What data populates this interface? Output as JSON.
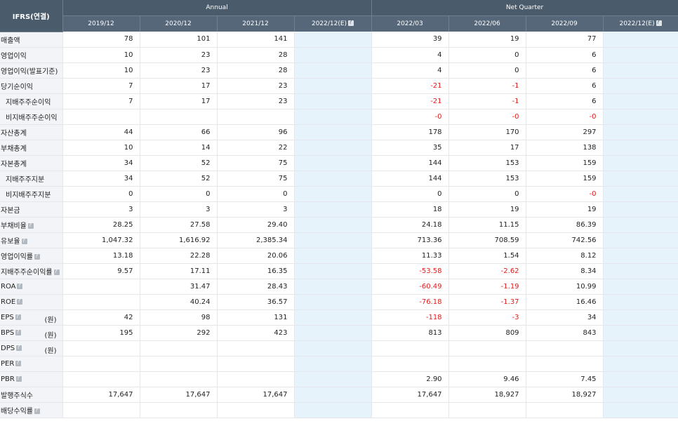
{
  "header": {
    "corner": "IFRS(연결)",
    "annual_label": "Annual",
    "quarter_label": "Net Quarter",
    "annual_periods": [
      "2019/12",
      "2020/12",
      "2021/12",
      "2022/12(E)"
    ],
    "quarter_periods": [
      "2022/03",
      "2022/06",
      "2022/09",
      "2022/12(E)"
    ]
  },
  "colors": {
    "header_bg": "#4a5b6c",
    "negative": "#e41a1a",
    "estimate_bg": "#e6f3fa",
    "label_bg": "#f2f4f7"
  },
  "rows": [
    {
      "label": "매출액",
      "indent": false,
      "help": false,
      "unit": "",
      "annual": [
        "78",
        "101",
        "141",
        ""
      ],
      "quarter": [
        "39",
        "19",
        "77",
        ""
      ]
    },
    {
      "label": "영업이익",
      "indent": false,
      "help": false,
      "unit": "",
      "annual": [
        "10",
        "23",
        "28",
        ""
      ],
      "quarter": [
        "4",
        "0",
        "6",
        ""
      ]
    },
    {
      "label": "영업이익(발표기준)",
      "indent": false,
      "help": false,
      "unit": "",
      "annual": [
        "10",
        "23",
        "28",
        ""
      ],
      "quarter": [
        "4",
        "0",
        "6",
        ""
      ]
    },
    {
      "label": "당기순이익",
      "indent": false,
      "help": false,
      "unit": "",
      "annual": [
        "7",
        "17",
        "23",
        ""
      ],
      "quarter": [
        "-21",
        "-1",
        "6",
        ""
      ]
    },
    {
      "label": "지배주주순이익",
      "indent": true,
      "help": false,
      "unit": "",
      "annual": [
        "7",
        "17",
        "23",
        ""
      ],
      "quarter": [
        "-21",
        "-1",
        "6",
        ""
      ]
    },
    {
      "label": "비지배주주순이익",
      "indent": true,
      "help": false,
      "unit": "",
      "annual": [
        "",
        "",
        "",
        ""
      ],
      "quarter": [
        "-0",
        "-0",
        "-0",
        ""
      ]
    },
    {
      "label": "자산총계",
      "indent": false,
      "help": false,
      "unit": "",
      "annual": [
        "44",
        "66",
        "96",
        ""
      ],
      "quarter": [
        "178",
        "170",
        "297",
        ""
      ]
    },
    {
      "label": "부채총계",
      "indent": false,
      "help": false,
      "unit": "",
      "annual": [
        "10",
        "14",
        "22",
        ""
      ],
      "quarter": [
        "35",
        "17",
        "138",
        ""
      ]
    },
    {
      "label": "자본총계",
      "indent": false,
      "help": false,
      "unit": "",
      "annual": [
        "34",
        "52",
        "75",
        ""
      ],
      "quarter": [
        "144",
        "153",
        "159",
        ""
      ]
    },
    {
      "label": "지배주주지분",
      "indent": true,
      "help": false,
      "unit": "",
      "annual": [
        "34",
        "52",
        "75",
        ""
      ],
      "quarter": [
        "144",
        "153",
        "159",
        ""
      ]
    },
    {
      "label": "비지배주주지분",
      "indent": true,
      "help": false,
      "unit": "",
      "annual": [
        "0",
        "0",
        "0",
        ""
      ],
      "quarter": [
        "0",
        "0",
        "-0",
        ""
      ]
    },
    {
      "label": "자본금",
      "indent": false,
      "help": false,
      "unit": "",
      "annual": [
        "3",
        "3",
        "3",
        ""
      ],
      "quarter": [
        "18",
        "19",
        "19",
        ""
      ]
    },
    {
      "label": "부채비율",
      "indent": false,
      "help": true,
      "unit": "",
      "annual": [
        "28.25",
        "27.58",
        "29.40",
        ""
      ],
      "quarter": [
        "24.18",
        "11.15",
        "86.39",
        ""
      ]
    },
    {
      "label": "유보율",
      "indent": false,
      "help": true,
      "unit": "",
      "annual": [
        "1,047.32",
        "1,616.92",
        "2,385.34",
        ""
      ],
      "quarter": [
        "713.36",
        "708.59",
        "742.56",
        ""
      ]
    },
    {
      "label": "영업이익률",
      "indent": false,
      "help": true,
      "unit": "",
      "annual": [
        "13.18",
        "22.28",
        "20.06",
        ""
      ],
      "quarter": [
        "11.33",
        "1.54",
        "8.12",
        ""
      ]
    },
    {
      "label": "지배주주순이익률",
      "indent": false,
      "help": true,
      "unit": "",
      "annual": [
        "9.57",
        "17.11",
        "16.35",
        ""
      ],
      "quarter": [
        "-53.58",
        "-2.62",
        "8.34",
        ""
      ]
    },
    {
      "label": "ROA",
      "indent": false,
      "help": true,
      "unit": "",
      "annual": [
        "",
        "31.47",
        "28.43",
        ""
      ],
      "quarter": [
        "-60.49",
        "-1.19",
        "10.99",
        ""
      ]
    },
    {
      "label": "ROE",
      "indent": false,
      "help": true,
      "unit": "",
      "annual": [
        "",
        "40.24",
        "36.57",
        ""
      ],
      "quarter": [
        "-76.18",
        "-1.37",
        "16.46",
        ""
      ]
    },
    {
      "label": "EPS",
      "indent": false,
      "help": true,
      "unit": "(원)",
      "annual": [
        "42",
        "98",
        "131",
        ""
      ],
      "quarter": [
        "-118",
        "-3",
        "34",
        ""
      ]
    },
    {
      "label": "BPS",
      "indent": false,
      "help": true,
      "unit": "(원)",
      "annual": [
        "195",
        "292",
        "423",
        ""
      ],
      "quarter": [
        "813",
        "809",
        "843",
        ""
      ]
    },
    {
      "label": "DPS",
      "indent": false,
      "help": true,
      "unit": "(원)",
      "annual": [
        "",
        "",
        "",
        ""
      ],
      "quarter": [
        "",
        "",
        "",
        ""
      ]
    },
    {
      "label": "PER",
      "indent": false,
      "help": true,
      "unit": "",
      "annual": [
        "",
        "",
        "",
        ""
      ],
      "quarter": [
        "",
        "",
        "",
        ""
      ]
    },
    {
      "label": "PBR",
      "indent": false,
      "help": true,
      "unit": "",
      "annual": [
        "",
        "",
        "",
        ""
      ],
      "quarter": [
        "2.90",
        "9.46",
        "7.45",
        ""
      ]
    },
    {
      "label": "발행주식수",
      "indent": false,
      "help": false,
      "unit": "",
      "annual": [
        "17,647",
        "17,647",
        "17,647",
        ""
      ],
      "quarter": [
        "17,647",
        "18,927",
        "18,927",
        ""
      ]
    },
    {
      "label": "배당수익률",
      "indent": false,
      "help": true,
      "unit": "",
      "annual": [
        "",
        "",
        "",
        ""
      ],
      "quarter": [
        "",
        "",
        "",
        ""
      ]
    }
  ]
}
